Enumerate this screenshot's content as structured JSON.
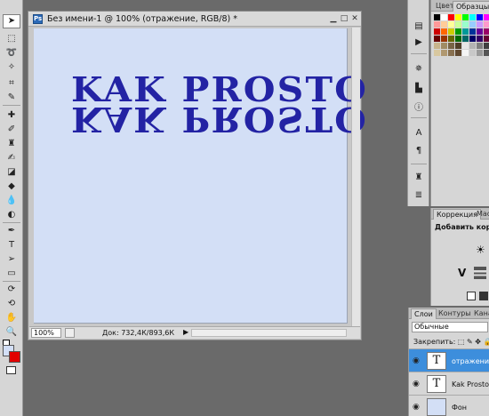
{
  "document": {
    "title": "Без имени-1 @ 100% (отражение, RGB/8) *",
    "canvas_text": "KAK PROSTO",
    "reflected_text": "KAK PROSTO",
    "text_color": "#2323a4",
    "canvas_color": "#d3dff6",
    "zoom": "100%",
    "doc_info": "Док: 732,4К/893,6К"
  },
  "swatches_panel": {
    "tabs": [
      "Цвет",
      "Образцы"
    ],
    "colors": [
      "#000000",
      "#ffffff",
      "#ff0000",
      "#ffff00",
      "#00ff00",
      "#00ffff",
      "#0000ff",
      "#ff00ff",
      "#ff9999",
      "#ffcc99",
      "#ffff99",
      "#ccff99",
      "#99ffcc",
      "#99ccff",
      "#cc99ff",
      "#ff99cc",
      "#cc0000",
      "#ff6600",
      "#cccc00",
      "#009900",
      "#009999",
      "#003399",
      "#660099",
      "#990066",
      "#660000",
      "#993300",
      "#666600",
      "#006600",
      "#006666",
      "#000066",
      "#330066",
      "#660033",
      "#c8b48c",
      "#a08c64",
      "#786446",
      "#504028",
      "#e6e6e6",
      "#b4b4b4",
      "#808080",
      "#404040",
      "#d8c8a0",
      "#b09870",
      "#887050",
      "#604830",
      "#f4f4f4",
      "#c8c8c8",
      "#999999",
      "#555555"
    ]
  },
  "adjustments_panel": {
    "tabs": [
      "Коррекция",
      "Маски"
    ],
    "label": "Добавить коррект"
  },
  "layers_panel": {
    "tabs": [
      "Слои",
      "Контуры",
      "Каналы"
    ],
    "blend_mode": "Обычные",
    "lock_label": "Закрепить:",
    "layers": [
      {
        "name": "отражение",
        "thumb": "T"
      },
      {
        "name": "Kak Prosto",
        "thumb": "T"
      },
      {
        "name": "Фон",
        "thumb": ""
      }
    ]
  }
}
